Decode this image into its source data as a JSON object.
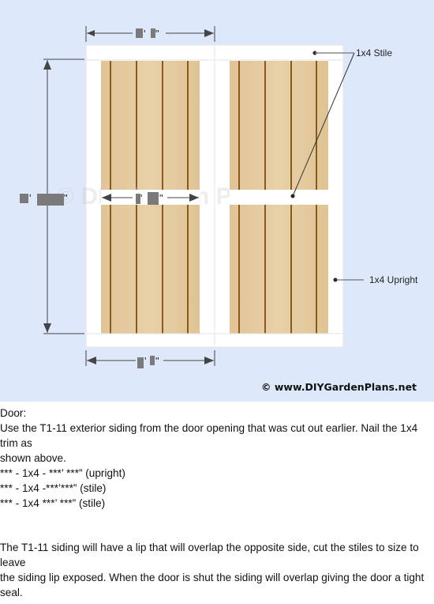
{
  "diagram": {
    "labels": {
      "stile": "1x4 Stile",
      "upright": "1x4 Upright"
    },
    "dimensions": {
      "top_width": "█' █\"",
      "height": "█' ███\"",
      "middle_width": "█' █\"",
      "bottom_width": "█' █\""
    },
    "watermark": "© DIY Garden Plans",
    "credit": "© www.DIYGardenPlans.net",
    "colors": {
      "background": "#dde9fb",
      "siding": "#e4cba0",
      "groove": "#8a5a1a",
      "trim": "#ffffff",
      "dimension_line": "#444444",
      "redaction": "#7a7a7a"
    }
  },
  "description": {
    "heading": "Door:",
    "line1": "Use the T1-11 exterior siding from the door opening that was cut out earlier. Nail the 1x4 trim as",
    "line2": "shown above.",
    "cut_list": [
      "*** - 1x4 - ***’ ***” (upright)",
      "*** - 1x4 -***’***” (stile)",
      "*** - 1x4 ***’ ***” (stile)"
    ],
    "note_line1": "The T1-11 siding will have a lip that will overlap the opposite side, cut the stiles to size to leave",
    "note_line2": "the siding lip exposed. When the door is shut the siding will overlap giving the door a tight seal."
  }
}
